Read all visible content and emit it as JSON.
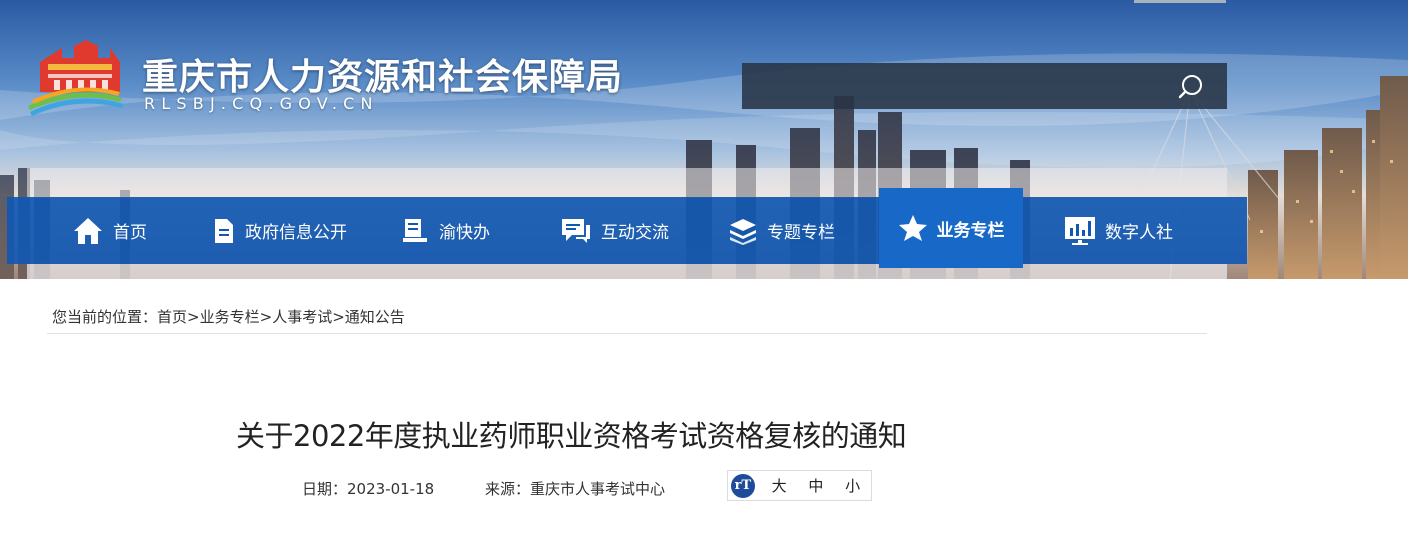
{
  "header": {
    "site_title": "重庆市人力资源和社会保障局",
    "site_domain": "RLSBJ.CQ.GOV.CN",
    "logo_icon": "government-building-logo",
    "search": {
      "placeholder": "",
      "icon": "search-icon"
    }
  },
  "nav": {
    "items": [
      {
        "label": "首页",
        "icon": "home-icon"
      },
      {
        "label": "政府信息公开",
        "icon": "document-icon"
      },
      {
        "label": "渝快办",
        "icon": "service-icon"
      },
      {
        "label": "互动交流",
        "icon": "chat-icon"
      },
      {
        "label": "专题专栏",
        "icon": "layers-icon"
      },
      {
        "label": "业务专栏",
        "icon": "star-icon",
        "active": true
      },
      {
        "label": "数字人社",
        "icon": "chart-icon"
      }
    ],
    "bar_color": "#1158b2",
    "active_color": "#1868c8"
  },
  "breadcrumb": {
    "prefix": "您当前的位置：",
    "items": [
      "首页",
      "业务专栏",
      "人事考试",
      "通知公告"
    ],
    "separator": ">"
  },
  "article": {
    "title": "关于2022年度执业药师职业资格考试资格复核的通知",
    "date_label": "日期：2023-01-18",
    "source_label": "来源：重庆市人事考试中心",
    "font_size": {
      "icon": "font-size-icon",
      "icon_text": "rT",
      "options": [
        "大",
        "中",
        "小"
      ]
    }
  }
}
